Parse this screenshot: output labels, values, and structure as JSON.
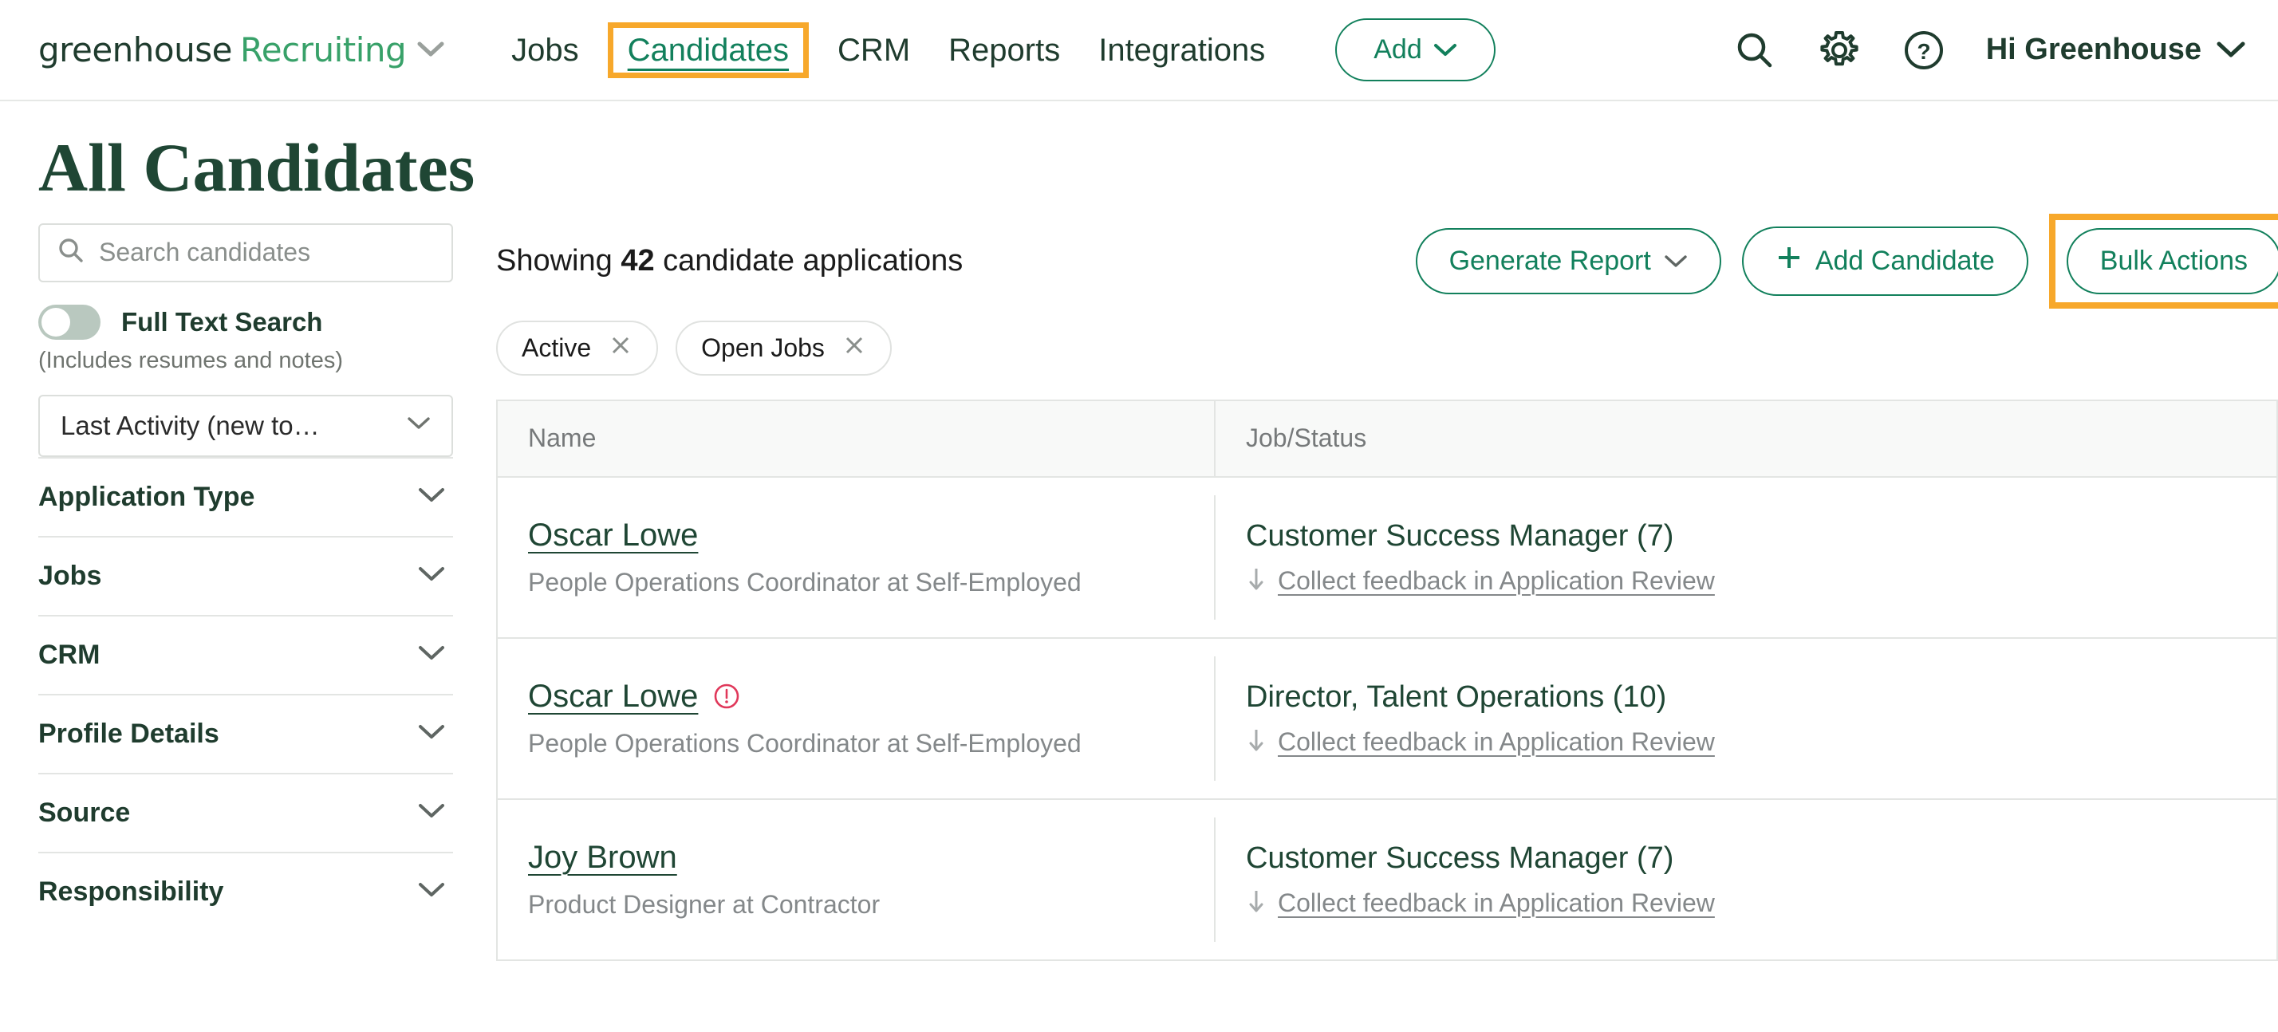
{
  "header": {
    "logo": {
      "brand": "greenhouse",
      "product": "Recruiting",
      "chevron_icon": "chevron-down-icon"
    },
    "nav": [
      {
        "label": "Jobs",
        "active": false
      },
      {
        "label": "Candidates",
        "active": true,
        "annotated": true
      },
      {
        "label": "CRM",
        "active": false
      },
      {
        "label": "Reports",
        "active": false
      },
      {
        "label": "Integrations",
        "active": false
      }
    ],
    "add_button": {
      "label": "Add",
      "chevron_icon": "chevron-down-icon"
    },
    "search_icon": "search-icon",
    "settings_icon": "gear-icon",
    "help_icon": "question-circle-icon",
    "greeting": "Hi Greenhouse",
    "greeting_chevron_icon": "chevron-down-icon"
  },
  "page": {
    "title": "All Candidates"
  },
  "sidebar": {
    "search": {
      "placeholder": "Search candidates",
      "value": "",
      "icon": "search-icon"
    },
    "full_text_search": {
      "label": "Full Text Search",
      "sub_label": "(Includes resumes and notes)",
      "state": "off"
    },
    "sort_select": {
      "value": "Last Activity (new to…",
      "chevron_icon": "chevron-down-icon"
    },
    "filters": [
      {
        "label": "Application Type",
        "chevron_icon": "chevron-down-icon"
      },
      {
        "label": "Jobs",
        "chevron_icon": "chevron-down-icon"
      },
      {
        "label": "CRM",
        "chevron_icon": "chevron-down-icon"
      },
      {
        "label": "Profile Details",
        "chevron_icon": "chevron-down-icon"
      },
      {
        "label": "Source",
        "chevron_icon": "chevron-down-icon"
      },
      {
        "label": "Responsibility",
        "chevron_icon": "chevron-down-icon"
      }
    ]
  },
  "main": {
    "showing_prefix": "Showing ",
    "showing_count": "42",
    "showing_suffix": " candidate applications",
    "buttons": {
      "generate_report": {
        "label": "Generate Report",
        "chevron_icon": "chevron-down-icon"
      },
      "add_candidate": {
        "label": "Add Candidate",
        "plus_icon": "plus-icon"
      },
      "bulk_actions": {
        "label": "Bulk Actions",
        "annotated": true
      }
    },
    "chips": [
      {
        "label": "Active",
        "close_icon": "close-icon"
      },
      {
        "label": "Open Jobs",
        "close_icon": "close-icon"
      }
    ],
    "table": {
      "columns": [
        "Name",
        "Job/Status"
      ],
      "rows": [
        {
          "name": "Oscar Lowe",
          "subtitle": "People Operations Coordinator at Self-Employed",
          "alert": false,
          "job": "Customer Success Manager (7)",
          "status": "Collect feedback in Application Review",
          "status_icon": "arrow-down-icon"
        },
        {
          "name": "Oscar Lowe",
          "subtitle": "People Operations Coordinator at Self-Employed",
          "alert": true,
          "alert_icon": "alert-circle-icon",
          "job": "Director, Talent Operations (10)",
          "status": "Collect feedback in Application Review",
          "status_icon": "arrow-down-icon"
        },
        {
          "name": "Joy Brown",
          "subtitle": "Product Designer at Contractor",
          "alert": false,
          "job": "Customer Success Manager (7)",
          "status": "Collect feedback in Application Review",
          "status_icon": "arrow-down-icon"
        }
      ]
    }
  },
  "colors": {
    "brand_green": "#12805c",
    "dark_green": "#1f4634",
    "accent_green": "#38a169",
    "annotation_orange": "#f7a82b",
    "alert_red": "#e0385a",
    "muted_gray": "#84888a"
  }
}
